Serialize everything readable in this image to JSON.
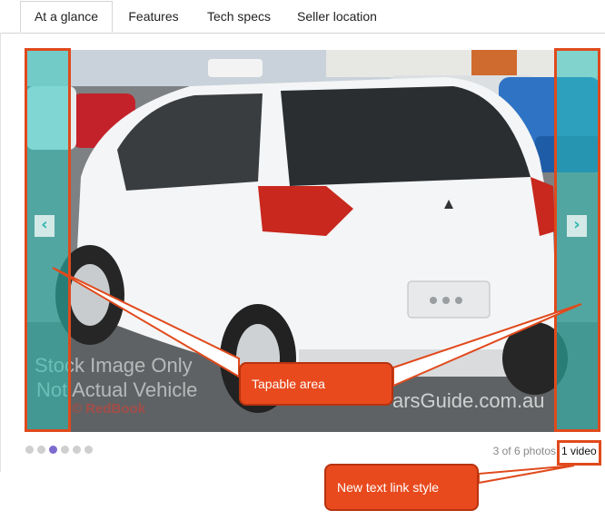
{
  "tabs": [
    {
      "label": "At a glance",
      "active": true
    },
    {
      "label": "Features",
      "active": false
    },
    {
      "label": "Tech specs",
      "active": false
    },
    {
      "label": "Seller location",
      "active": false
    }
  ],
  "photo": {
    "prev_icon": "chevron-left-icon",
    "next_icon": "chevron-right-icon",
    "prev_glyph": "‹",
    "next_glyph": "›",
    "watermark_line1": "Stock Image Only",
    "watermark_line2": "Not Actual Vehicle",
    "watermark_brand": "© RedBook",
    "watermark_site": "arsGuide.com.au"
  },
  "gallery": {
    "dot_count": 6,
    "active_dot": 3,
    "photo_count_text": "3 of 6 photos",
    "video_link": "1 video"
  },
  "annotations": {
    "tap_label": "Tapable area",
    "link_label": "New text link style",
    "accent_color": "#e84a1e",
    "overlay_color": "#2cc4ba"
  }
}
